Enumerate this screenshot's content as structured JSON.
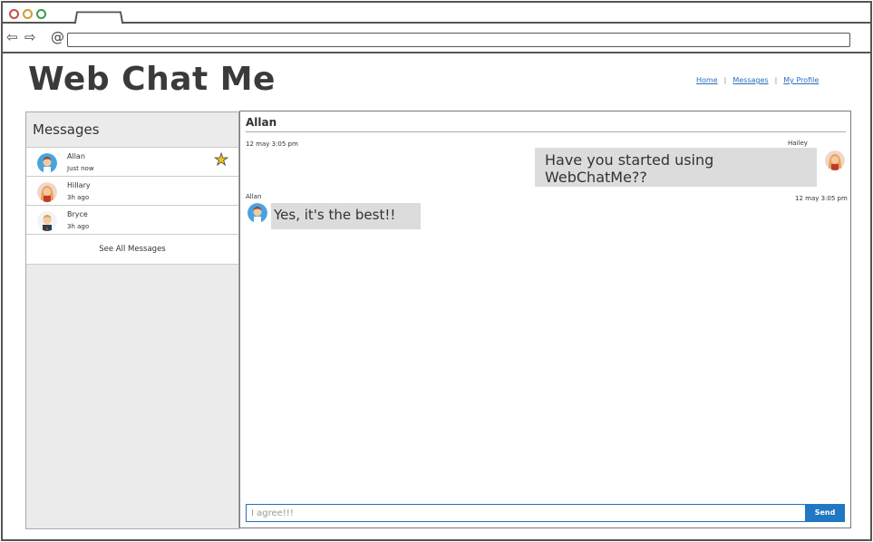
{
  "browser": {
    "back_icon": "arrow-left-icon",
    "forward_icon": "arrow-right-icon",
    "reload_icon": "reload-icon",
    "url": ""
  },
  "header": {
    "title": "Web Chat Me",
    "nav": [
      {
        "label": "Home"
      },
      {
        "label": "Messages"
      },
      {
        "label": "My Profile"
      }
    ],
    "nav_separator": "|"
  },
  "sidebar": {
    "title": "Messages",
    "conversations": [
      {
        "name": "Allan",
        "time": "Just now",
        "starred": true
      },
      {
        "name": "Hillary",
        "time": "3h ago",
        "starred": false
      },
      {
        "name": "Bryce",
        "time": "3h ago",
        "starred": false
      }
    ],
    "see_all_label": "See All Messages"
  },
  "chat": {
    "title": "Allan",
    "messages": [
      {
        "sender": "Hailey",
        "timestamp": "12 may 3:05 pm",
        "text": "Have you started using WebChatMe??",
        "outgoing": true
      },
      {
        "sender": "Allan",
        "timestamp": "12 may 3:05 pm",
        "text": "Yes, it's the best!!",
        "outgoing": false
      }
    ],
    "composer": {
      "value": "I agree!!!",
      "send_label": "Send"
    }
  },
  "colors": {
    "accent": "#1f78c1",
    "link": "#2a6ebb",
    "sidebar_bg": "#ebebeb",
    "bubble_bg": "#dcdcdc",
    "star": "#f0c419"
  }
}
